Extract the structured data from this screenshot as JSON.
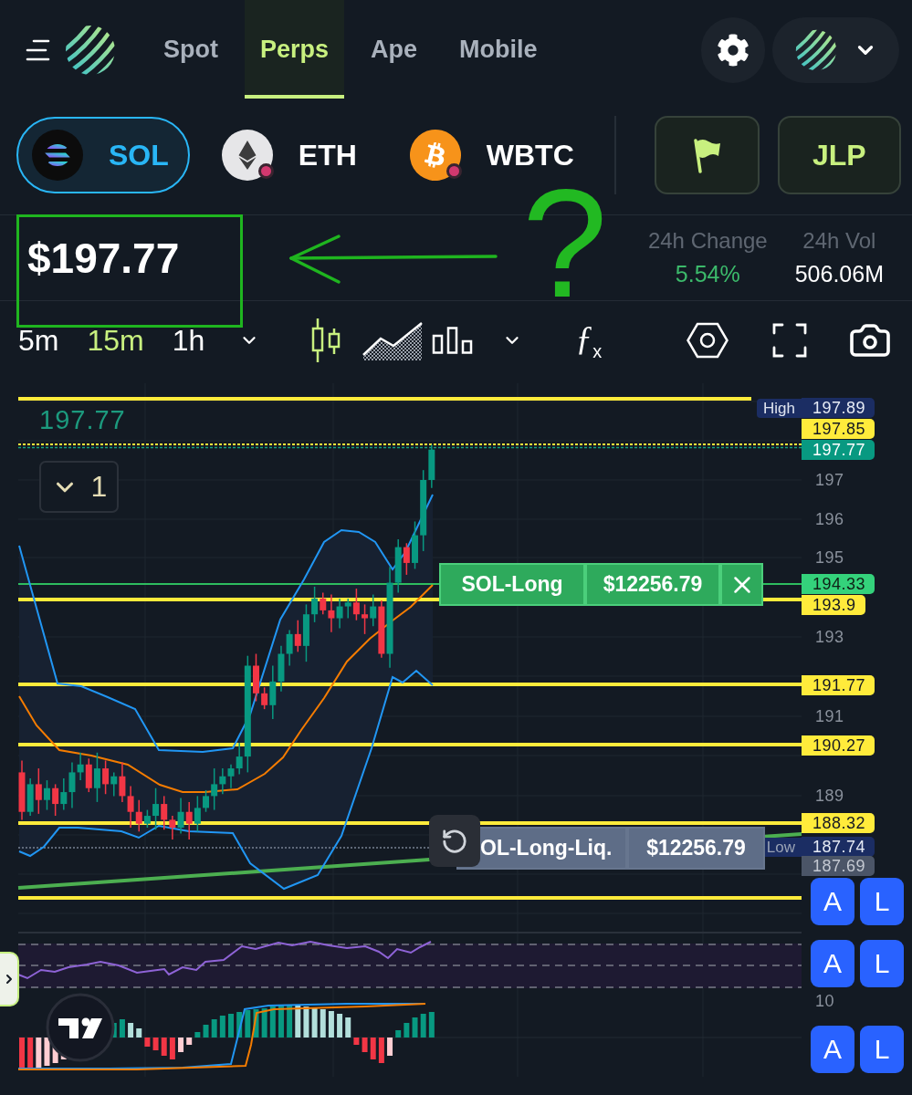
{
  "header": {
    "nav_tabs": [
      {
        "label": "Spot",
        "selected": false
      },
      {
        "label": "Perps",
        "selected": true
      },
      {
        "label": "Ape",
        "selected": false
      },
      {
        "label": "Mobile",
        "selected": false
      }
    ]
  },
  "assets": [
    {
      "symbol": "SOL",
      "kind": "sol",
      "selected": true,
      "badge": false
    },
    {
      "symbol": "ETH",
      "kind": "eth",
      "selected": false,
      "badge": true
    },
    {
      "symbol": "WBTC",
      "kind": "btc",
      "selected": false,
      "badge": true
    }
  ],
  "pool_button": {
    "label": "JLP"
  },
  "market": {
    "price": "$197.77",
    "stats": [
      {
        "label": "24h Change",
        "value": "5.54%",
        "kind": "change"
      },
      {
        "label": "24h Vol",
        "value": "506.06M",
        "kind": "plain"
      }
    ]
  },
  "annotation": {
    "mark": "?"
  },
  "toolbar": {
    "timeframes": [
      {
        "label": "5m",
        "selected": false
      },
      {
        "label": "15m",
        "selected": true
      },
      {
        "label": "1h",
        "selected": false
      }
    ],
    "chart_types": [
      {
        "kind": "candles",
        "selected": true
      },
      {
        "kind": "area",
        "selected": false
      },
      {
        "kind": "columns",
        "selected": false
      }
    ],
    "indicators": "ƒ$_{x}$"
  },
  "chart": {
    "symbol_price": "197.77",
    "collapse_count": "1",
    "axis_ticks": [
      "197",
      "196",
      "195",
      "193",
      "191",
      "189"
    ],
    "pane_ticks": [
      "10"
    ],
    "price_tags": [
      {
        "kind": "high",
        "tag": "High",
        "text": "197.89"
      },
      {
        "kind": "level",
        "text": "197.85"
      },
      {
        "kind": "last",
        "text": "197.77"
      },
      {
        "kind": "position",
        "text": "194.33"
      },
      {
        "kind": "level",
        "text": "193.9"
      },
      {
        "kind": "level",
        "text": "191.77"
      },
      {
        "kind": "level",
        "text": "190.27"
      },
      {
        "kind": "level",
        "text": "188.32"
      },
      {
        "kind": "low",
        "tag": "Low",
        "text": "187.74"
      },
      {
        "kind": "muted",
        "text": "187.69"
      }
    ],
    "order": {
      "name": "SOL-Long",
      "amount": "$12256.79"
    },
    "liquidation": {
      "name": "OL-Long-Liq.",
      "amount": "$12256.79"
    }
  },
  "pane_buttons": [
    {
      "labels": [
        "A",
        "L"
      ]
    },
    {
      "labels": [
        "A",
        "L"
      ]
    },
    {
      "labels": [
        "A",
        "L"
      ]
    }
  ]
}
